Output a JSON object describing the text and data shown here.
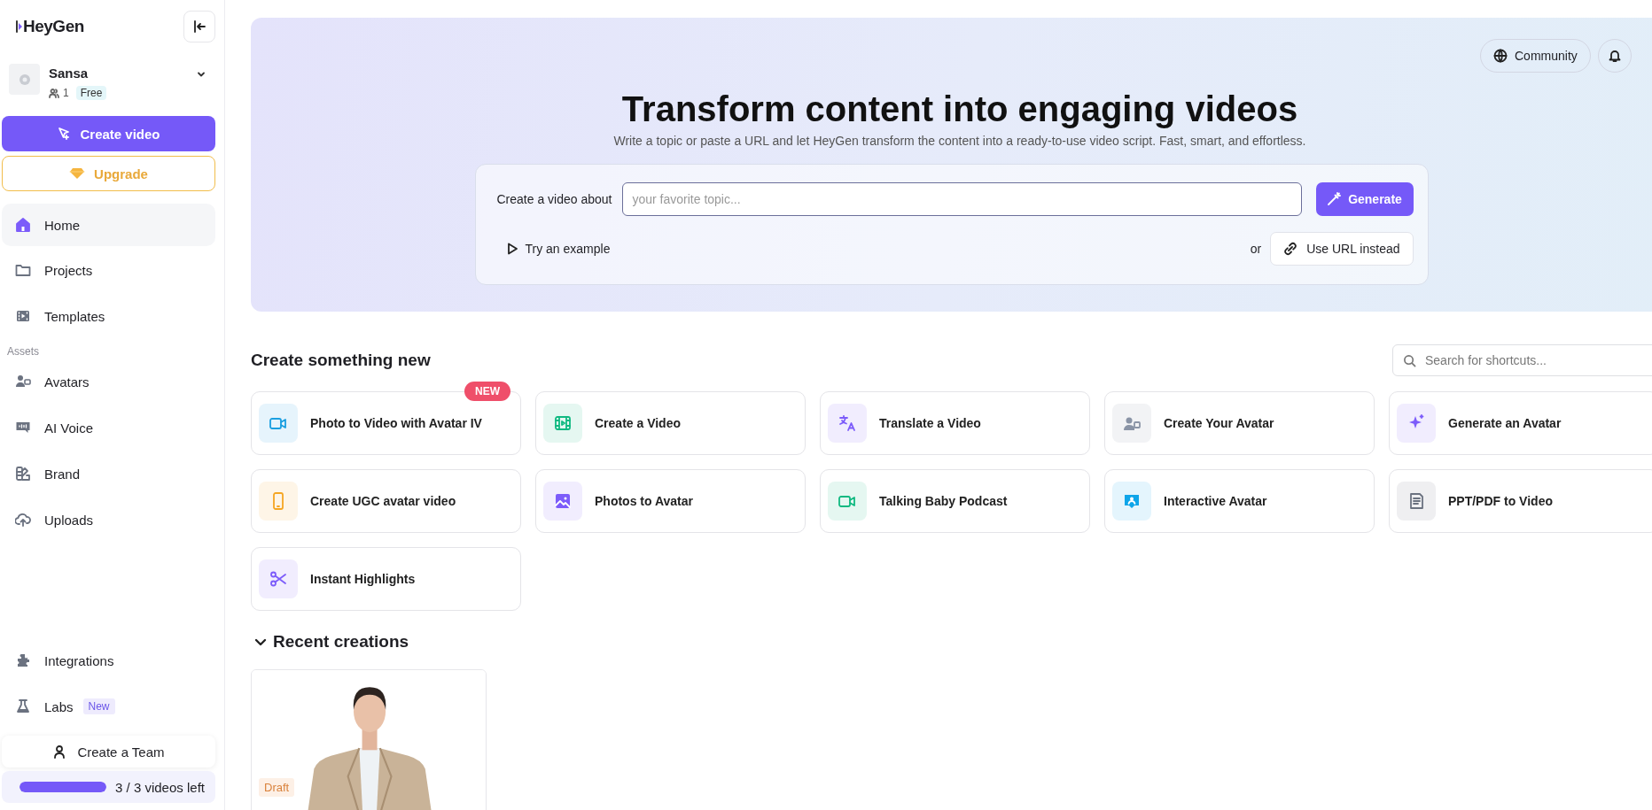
{
  "sidebar": {
    "logo": "HeyGen",
    "profile": {
      "name": "Sansa",
      "members": "1",
      "plan": "Free"
    },
    "create_button": "Create video",
    "upgrade_button": "Upgrade",
    "nav": [
      {
        "label": "Home",
        "selected": true
      },
      {
        "label": "Projects",
        "selected": false
      },
      {
        "label": "Templates",
        "selected": false
      }
    ],
    "assets_heading": "Assets",
    "assets": [
      {
        "label": "Avatars",
        "selected": false
      },
      {
        "label": "AI Voice",
        "selected": false
      },
      {
        "label": "Brand",
        "selected": false
      },
      {
        "label": "Uploads",
        "selected": false
      }
    ],
    "bottom": [
      {
        "label": "Integrations",
        "selected": false
      },
      {
        "label": "Labs",
        "badge": "New",
        "selected": false
      }
    ],
    "team_button": "Create a Team",
    "usage": {
      "level": 1,
      "text": "3 / 3 videos left"
    }
  },
  "hero": {
    "community_button": "Community",
    "title": "Transform content into engaging videos",
    "subtitle": "Write a topic or paste a URL and let HeyGen transform the content into a ready-to-use video script. Fast, smart, and effortless.",
    "prompt_label": "Create a video about",
    "input": {
      "placeholder": "your favorite topic..."
    },
    "generate_button": "Generate",
    "example_button": "Try an example",
    "or": "or",
    "url_button": "Use URL instead"
  },
  "shortcuts": {
    "title": "Create something new",
    "search": {
      "placeholder": "Search for shortcuts..."
    },
    "items": [
      {
        "label": "Photo to Video with Avatar IV",
        "badge": "NEW",
        "color": "#1a9fe0"
      },
      {
        "label": "Create a Video",
        "color": "#10b981"
      },
      {
        "label": "Translate a Video",
        "color": "#7c5cfa"
      },
      {
        "label": "Create Your Avatar",
        "color": "#8a94a6"
      },
      {
        "label": "Generate an Avatar",
        "color": "#7c5cfa"
      },
      {
        "label": "Create UGC avatar video",
        "color": "#f5a623"
      },
      {
        "label": "Photos to Avatar",
        "color": "#7c5cfa"
      },
      {
        "label": "Talking Baby Podcast",
        "color": "#10b981"
      },
      {
        "label": "Interactive Avatar",
        "color": "#0ea5e9"
      },
      {
        "label": "PPT/PDF to Video",
        "color": "#6b7280"
      },
      {
        "label": "Instant Highlights",
        "color": "#7c5cfa"
      }
    ]
  },
  "recent": {
    "title": "Recent creations",
    "expanded": true,
    "items": [
      {
        "kind": "picture",
        "status": "Draft"
      }
    ]
  }
}
